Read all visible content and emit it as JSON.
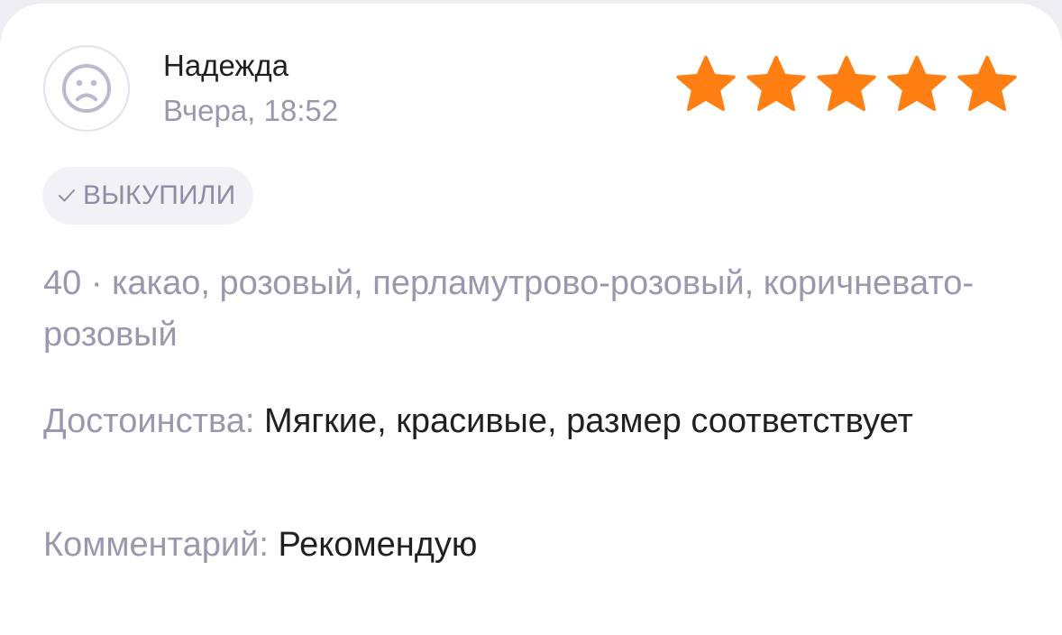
{
  "review": {
    "author": "Надежда",
    "date": "Вчера, 18:52",
    "rating": 5,
    "rating_max": 5,
    "badge": {
      "check_glyph": "✓",
      "label": "ВЫКУПИЛИ"
    },
    "variant": "40 · какао, розовый, перламутрово-розовый, коричневато-розовый",
    "pros": {
      "title": "Достоинства:",
      "text": "Мягкие, красивые, размер соответствует"
    },
    "comment": {
      "title": "Комментарий:",
      "text": "Рекомендую"
    }
  },
  "icons": {
    "avatar": "sad-face-icon",
    "star": "star-icon",
    "check": "check-icon"
  },
  "colors": {
    "star": "#ff7f12",
    "muted_text": "#9b97ae",
    "primary_text": "#1f1f24",
    "badge_bg": "#f2f1f5",
    "avatar_stroke": "#bcb8cd"
  }
}
